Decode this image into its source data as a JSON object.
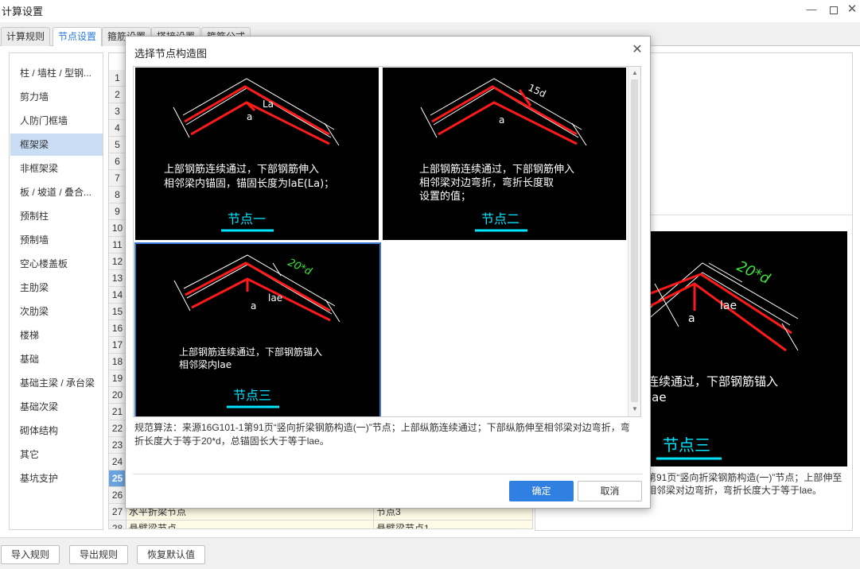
{
  "window": {
    "title": "计算设置"
  },
  "tabs": [
    "计算规则",
    "节点设置",
    "箍筋设置",
    "搭接设置",
    "箍筋公式"
  ],
  "active_tab": "节点设置",
  "categories": [
    "柱 / 墙柱 / 型钢...",
    "剪力墙",
    "人防门框墙",
    "框架梁",
    "非框架梁",
    "板 / 坡道 / 叠合...",
    "预制柱",
    "预制墙",
    "空心楼盖板",
    "主肋梁",
    "次肋梁",
    "楼梯",
    "基础",
    "基础主梁 / 承台梁",
    "基础次梁",
    "砌体结构",
    "其它",
    "基坑支护"
  ],
  "selected_category": "框架梁",
  "row_numbers": [
    "1",
    "2",
    "3",
    "4",
    "5",
    "6",
    "7",
    "8",
    "9",
    "10",
    "11",
    "12",
    "13",
    "14",
    "15",
    "16",
    "17",
    "18",
    "19",
    "20",
    "21",
    "22",
    "23",
    "24",
    "25",
    "26",
    "27",
    "28"
  ],
  "selected_row": "25",
  "visible_rows": [
    {
      "num": "27",
      "name": "水平折梁节点",
      "value": "节点3"
    },
    {
      "num": "28",
      "name": "悬臂梁节点",
      "value": "悬臂梁节点1"
    }
  ],
  "preview": {
    "figure": {
      "dim1": "20*d",
      "dim2": "lae",
      "angle": "a",
      "text": "连续通过，下部钢筋锚入",
      "text2": "lae",
      "caption": "节点三"
    },
    "desc": "第91页“竖向折梁钢筋构造(一)”节点；上部伸至相邻梁对边弯折，弯折长度大于等于lae。"
  },
  "bottom_buttons": [
    "导入规则",
    "导出规则",
    "恢复默认值"
  ],
  "dialog": {
    "title": "选择节点构造图",
    "thumbs": [
      {
        "dim": "La",
        "angle": "a",
        "line1": "上部钢筋连续通过，下部钢筋伸入",
        "line2": "相邻梁内锚固，锚固长度为laE(La)；",
        "line3": "",
        "caption": "节点一"
      },
      {
        "dim": "15d",
        "angle": "a",
        "line1": "上部钢筋连续通过，下部钢筋伸入",
        "line2": "相邻梁对边弯折，弯折长度取",
        "line3": "设置的值；",
        "caption": "节点二"
      },
      {
        "dim": "20*d",
        "dim2": "lae",
        "angle": "a",
        "line1": "上部钢筋连续通过，下部钢筋锚入",
        "line2": "相邻梁内lae",
        "line3": "",
        "caption": "节点三"
      }
    ],
    "selected_thumb": "节点三",
    "description": "规范算法：来源16G101-1第91页“竖向折梁钢筋构造(一)”节点；上部纵筋连续通过；下部纵筋伸至相邻梁对边弯折，弯折长度大于等于20*d，总锚固长大于等于lae。",
    "ok_label": "确定",
    "cancel_label": "取消"
  },
  "colors": {
    "accent": "#2f80e0",
    "cyan": "#00e5ff",
    "rebar": "#ff1a1a",
    "green": "#39e639"
  }
}
